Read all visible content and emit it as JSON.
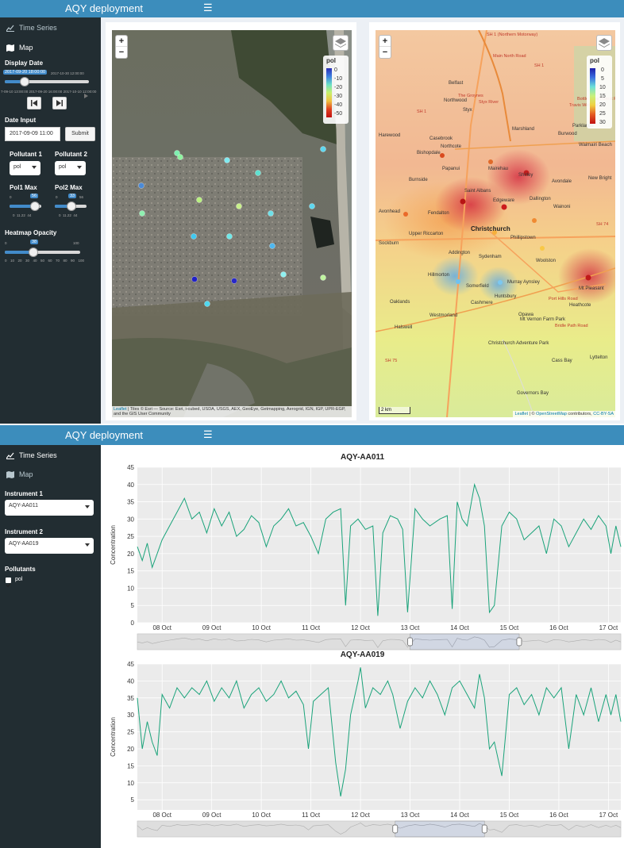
{
  "app_title": "AQY deployment",
  "menu": {
    "time_series": "Time Series",
    "map": "Map"
  },
  "map_sidebar": {
    "display_date_label": "Display Date",
    "display_date_value": "2017-09-20 18:00:00",
    "display_date_end": "2017-10-30 12:00:00",
    "display_date_ticks": "7-09-10 13:00:00 2017-09-20 16:00:00 2017-10-10 12:00:00",
    "date_input_label": "Date Input",
    "date_input_value": "2017-09-09 11:00",
    "submit_label": "Submit",
    "pollutant1_label": "Pollutant 1",
    "pollutant2_label": "Pollutant 2",
    "pollutant1_value": "pol",
    "pollutant2_value": "pol",
    "pol1max_label": "Pol1 Max",
    "pol2max_label": "Pol2 Max",
    "pol1max_value": "56",
    "pol2max_value": "33",
    "pol1max_min": "0",
    "pol2max_min": "0",
    "pol2max_max": "56",
    "pol1max_ticks": "0  11.22  44",
    "pol2max_ticks": "0  11.22  44",
    "heatmap_opacity_label": "Heatmap Opacity",
    "heatmap_opacity_value": "38",
    "heatmap_opacity_max": "100",
    "heatmap_ticks": "0  10  20  30  40  50  60  70  80  90  100"
  },
  "map_left": {
    "legend_title": "pol",
    "legend_ticks": [
      "0",
      "-10",
      "-20",
      "-30",
      "-40",
      "-50"
    ],
    "attribution_link": "Leaflet",
    "attribution_text": " | Tiles © Esri — Source: Esri, i-cubed, USDA, USGS, AEX, GeoEye, Getmapping, Aerogrid, IGN, IGP, UPR-EGP, and the GIS User Community"
  },
  "map_right": {
    "legend_title": "pol",
    "legend_ticks": [
      "0",
      "5",
      "10",
      "15",
      "20",
      "25",
      "30"
    ],
    "scale_label": "2 km",
    "attribution_link": "Leaflet",
    "attribution_mid": " | © ",
    "attribution_osm": "OpenStreetMap",
    "attribution_after": " contributors, ",
    "attribution_license": "CC-BY-SA",
    "places": [
      {
        "name": "Christchurch",
        "big": true
      },
      {
        "name": "Belfast"
      },
      {
        "name": "Northwood"
      },
      {
        "name": "Styx"
      },
      {
        "name": "Marshland"
      },
      {
        "name": "Casebrook"
      },
      {
        "name": "Northcote"
      },
      {
        "name": "Bishopdale"
      },
      {
        "name": "Harewood"
      },
      {
        "name": "Burwood"
      },
      {
        "name": "Parklands"
      },
      {
        "name": "Waimairi Beach"
      },
      {
        "name": "Papanui"
      },
      {
        "name": "Mairehau"
      },
      {
        "name": "Shirley"
      },
      {
        "name": "Avondale"
      },
      {
        "name": "New Bright"
      },
      {
        "name": "Burnside"
      },
      {
        "name": "Saint Albans"
      },
      {
        "name": "Edgeware"
      },
      {
        "name": "Dallington"
      },
      {
        "name": "Avonhead"
      },
      {
        "name": "Fendalton"
      },
      {
        "name": "Wainoni"
      },
      {
        "name": "Upper Riccarton"
      },
      {
        "name": "Phillipstown"
      },
      {
        "name": "Sockburn"
      },
      {
        "name": "Addington"
      },
      {
        "name": "Sydenham"
      },
      {
        "name": "Woolston"
      },
      {
        "name": "Hillmorton"
      },
      {
        "name": "Somerfield"
      },
      {
        "name": "Murray Aynsley"
      },
      {
        "name": "Mt Pleasant"
      },
      {
        "name": "Oaklands"
      },
      {
        "name": "Huntsbury"
      },
      {
        "name": "Heathcote"
      },
      {
        "name": "Cashmere"
      },
      {
        "name": "Westmorland"
      },
      {
        "name": "Halswell"
      },
      {
        "name": "Opawa"
      },
      {
        "name": "Cass Bay"
      },
      {
        "name": "Lyttelton"
      },
      {
        "name": "Governors Bay"
      },
      {
        "name": "Mt Vernon Farm Park"
      },
      {
        "name": "Christchurch Adventure Park"
      }
    ],
    "roads": [
      "SH 1 (Northern Motorway)",
      "SH 1",
      "SH 1",
      "SH 74",
      "SH 75",
      "Main North Road",
      "Port Hills Road",
      "Bridle Path Road",
      "The Groynes",
      "Travis Wetland",
      "Styx River",
      "Bottle Lake Forest Park"
    ]
  },
  "ts_sidebar": {
    "instrument1_label": "Instrument 1",
    "instrument1_value": "AQY-AA011",
    "instrument2_label": "Instrument 2",
    "instrument2_value": "AQY-AA019",
    "pollutants_label": "Pollutants",
    "pollutant_item": "pol"
  },
  "colors": {
    "topbar": "#3c8dbc",
    "sidebar": "#222d32",
    "content_bg": "#ecf0f5",
    "series": "#1aa37a",
    "plot_bg": "#e5e5e5"
  },
  "chart_data": [
    {
      "type": "line",
      "title": "AQY-AA011",
      "ylabel": "Concentration",
      "xlabel": "",
      "ylim": [
        0,
        45
      ],
      "y_ticks": [
        0,
        5,
        10,
        15,
        20,
        25,
        30,
        35,
        40,
        45
      ],
      "x_tick_labels": [
        "08 Oct",
        "09 Oct",
        "10 Oct",
        "11 Oct",
        "12 Oct",
        "13 Oct",
        "14 Oct",
        "15 Oct",
        "16 Oct",
        "17 Oct"
      ],
      "x_tick_days": [
        8,
        9,
        10,
        11,
        12,
        13,
        14,
        15,
        16,
        17
      ],
      "x_range": [
        7.5,
        17.25
      ],
      "grid": true,
      "series": [
        {
          "x": [
            7.5,
            7.6,
            7.7,
            7.8,
            7.9,
            8.0,
            8.15,
            8.3,
            8.45,
            8.6,
            8.75,
            8.9,
            9.05,
            9.2,
            9.35,
            9.5,
            9.65,
            9.8,
            9.95,
            10.1,
            10.25,
            10.4,
            10.55,
            10.7,
            10.85,
            11.0,
            11.15,
            11.3,
            11.45,
            11.6,
            11.7,
            11.8,
            11.95,
            12.1,
            12.25,
            12.35,
            12.45,
            12.6,
            12.75,
            12.85,
            12.95,
            13.1,
            13.25,
            13.4,
            13.6,
            13.75,
            13.85,
            13.95,
            14.05,
            14.15,
            14.3,
            14.4,
            14.5,
            14.6,
            14.7,
            14.85,
            15.0,
            15.15,
            15.3,
            15.45,
            15.6,
            15.75,
            15.9,
            16.05,
            16.2,
            16.35,
            16.5,
            16.65,
            16.8,
            16.95,
            17.05,
            17.15,
            17.25
          ],
          "y": [
            22,
            18,
            23,
            16,
            20,
            24,
            28,
            32,
            36,
            30,
            32,
            26,
            33,
            28,
            32,
            25,
            27,
            31,
            29,
            22,
            28,
            30,
            33,
            28,
            29,
            25,
            20,
            30,
            32,
            33,
            5,
            28,
            30,
            27,
            28,
            2,
            26,
            31,
            30,
            27,
            3,
            33,
            30,
            28,
            30,
            31,
            4,
            35,
            30,
            28,
            40,
            36,
            28,
            3,
            5,
            28,
            32,
            30,
            24,
            26,
            28,
            20,
            30,
            28,
            22,
            26,
            30,
            27,
            31,
            28,
            20,
            28,
            22
          ]
        }
      ]
    },
    {
      "type": "line",
      "title": "AQY-AA019",
      "ylabel": "Concentration",
      "xlabel": "",
      "ylim": [
        2,
        45
      ],
      "y_ticks": [
        5,
        10,
        15,
        20,
        25,
        30,
        35,
        40,
        45
      ],
      "x_tick_labels": [
        "08 Oct",
        "09 Oct",
        "10 Oct",
        "11 Oct",
        "12 Oct",
        "13 Oct",
        "14 Oct",
        "15 Oct",
        "16 Oct",
        "17 Oct"
      ],
      "x_tick_days": [
        8,
        9,
        10,
        11,
        12,
        13,
        14,
        15,
        16,
        17
      ],
      "x_range": [
        7.5,
        17.25
      ],
      "grid": true,
      "series": [
        {
          "x": [
            7.5,
            7.6,
            7.7,
            7.8,
            7.9,
            8.0,
            8.15,
            8.3,
            8.45,
            8.6,
            8.75,
            8.9,
            9.05,
            9.2,
            9.35,
            9.5,
            9.65,
            9.8,
            9.95,
            10.1,
            10.25,
            10.4,
            10.55,
            10.7,
            10.85,
            10.95,
            11.05,
            11.2,
            11.35,
            11.5,
            11.6,
            11.7,
            11.8,
            11.95,
            12.0,
            12.1,
            12.25,
            12.4,
            12.55,
            12.65,
            12.8,
            12.95,
            13.1,
            13.25,
            13.4,
            13.55,
            13.7,
            13.85,
            14.0,
            14.15,
            14.3,
            14.4,
            14.5,
            14.6,
            14.7,
            14.85,
            15.0,
            15.15,
            15.3,
            15.45,
            15.6,
            15.75,
            15.9,
            16.05,
            16.2,
            16.35,
            16.5,
            16.65,
            16.8,
            16.95,
            17.05,
            17.15,
            17.25
          ],
          "y": [
            35,
            20,
            28,
            22,
            18,
            36,
            32,
            38,
            35,
            38,
            36,
            40,
            34,
            38,
            35,
            40,
            32,
            36,
            38,
            34,
            36,
            40,
            35,
            37,
            33,
            20,
            34,
            36,
            38,
            16,
            6,
            14,
            30,
            40,
            44,
            32,
            38,
            36,
            40,
            36,
            26,
            34,
            38,
            35,
            40,
            36,
            30,
            38,
            40,
            36,
            32,
            42,
            35,
            20,
            22,
            12,
            36,
            38,
            33,
            36,
            30,
            38,
            35,
            38,
            20,
            36,
            30,
            38,
            28,
            36,
            30,
            36,
            28
          ]
        }
      ]
    }
  ]
}
